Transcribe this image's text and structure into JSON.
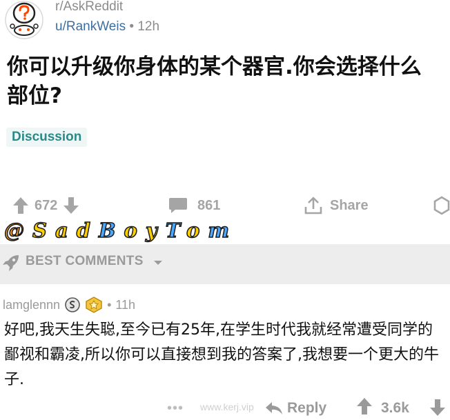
{
  "post": {
    "subreddit": "r/AskReddit",
    "username": "u/RankWeis",
    "separator": "•",
    "time": "12h",
    "title": "你可以升级你身体的某个器官.你会选择什么部位?",
    "flair": "Discussion",
    "upvotes": "672",
    "comments": "861",
    "share_label": "Share"
  },
  "watermark": {
    "chars": [
      "@",
      "S",
      "a",
      "d",
      "B",
      "o",
      "y",
      "T",
      "o",
      "m"
    ]
  },
  "sort": {
    "label": "BEST COMMENTS"
  },
  "comment": {
    "username": "lamglennn",
    "separator": "•",
    "time": "11h",
    "body": "好吧,我天生失聪,至今已有25年,在学生时代我就经常遭受同学的鄙视和霸凌,所以你可以直接想到我的答案了,我想要一个更大的牛子.",
    "more": "•••",
    "site_watermark": "www.kerj.vip",
    "reply_label": "Reply",
    "score": "3.6k"
  },
  "colors": {
    "username_blue": "#3d6f9e",
    "flair_teal": "#2a8a8a",
    "muted_gray": "#a5a5a5",
    "sort_bar_bg": "#ededed"
  },
  "icons": {
    "avatar": "askreddit-question-mark-avatar",
    "upvote": "arrow-up-icon",
    "downvote": "arrow-down-icon",
    "comments": "speech-bubble-icon",
    "share": "share-icon",
    "award": "award-icon",
    "sort": "rocket-icon",
    "sort_caret": "chevron-down-icon",
    "silver_award": "silver-award-icon",
    "gold_award": "gold-award-icon",
    "reply": "reply-arrow-icon"
  }
}
